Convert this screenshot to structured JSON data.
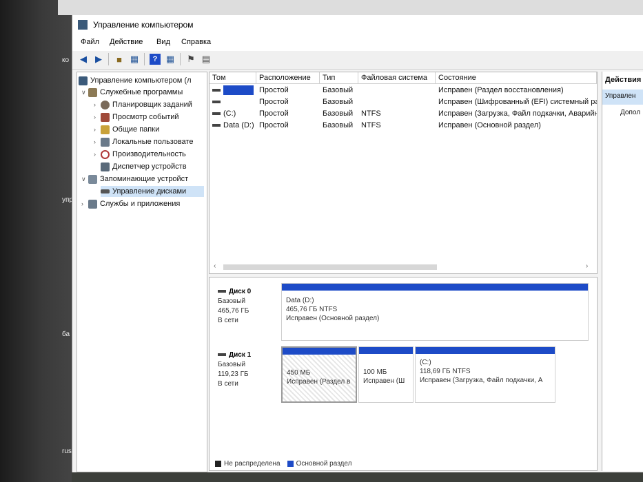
{
  "side": {
    "t1": "ко",
    "t2": "упр",
    "t3": "ба",
    "t4": "rus"
  },
  "window": {
    "title": "Управление компьютером"
  },
  "menu": [
    "Файл",
    "Действие",
    "Вид",
    "Справка"
  ],
  "toolbar": [
    "back-icon",
    "forward-icon",
    "up-icon",
    "view-icon",
    "help-icon",
    "properties-icon",
    "connect-icon",
    "list-icon"
  ],
  "tree": {
    "root": "Управление компьютером (л",
    "items": [
      {
        "label": "Служебные программы",
        "level": 1,
        "expanded": true
      },
      {
        "label": "Планировщик заданий",
        "level": 2
      },
      {
        "label": "Просмотр событий",
        "level": 2
      },
      {
        "label": "Общие папки",
        "level": 2
      },
      {
        "label": "Локальные пользовате",
        "level": 2
      },
      {
        "label": "Производительность",
        "level": 2
      },
      {
        "label": "Диспетчер устройств",
        "level": 2
      },
      {
        "label": "Запоминающие устройст",
        "level": 1,
        "expanded": true
      },
      {
        "label": "Управление дисками",
        "level": 2,
        "selected": true
      },
      {
        "label": "Службы и приложения",
        "level": 1
      }
    ]
  },
  "volumes": {
    "headers": [
      "Том",
      "Расположение",
      "Тип",
      "Файловая система",
      "Состояние"
    ],
    "rows": [
      {
        "tom": "",
        "loc": "Простой",
        "type": "Базовый",
        "fs": "",
        "state": "Исправен (Раздел восстановления)"
      },
      {
        "tom": "",
        "loc": "Простой",
        "type": "Базовый",
        "fs": "",
        "state": "Исправен (Шифрованный (EFI) системный ра"
      },
      {
        "tom": "(C:)",
        "loc": "Простой",
        "type": "Базовый",
        "fs": "NTFS",
        "state": "Исправен (Загрузка, Файл подкачки, Аварийн"
      },
      {
        "tom": "Data (D:)",
        "loc": "Простой",
        "type": "Базовый",
        "fs": "NTFS",
        "state": "Исправен (Основной раздел)"
      }
    ]
  },
  "disks": [
    {
      "name": "Диск 0",
      "kind": "Базовый",
      "size": "465,76 ГБ",
      "status": "В сети",
      "partitions": [
        {
          "title": "Data  (D:)",
          "size": "465,76 ГБ NTFS",
          "state": "Исправен (Основной раздел)"
        }
      ]
    },
    {
      "name": "Диск 1",
      "kind": "Базовый",
      "size": "119,23 ГБ",
      "status": "В сети",
      "partitions": [
        {
          "title": "",
          "size": "450 МБ",
          "state": "Исправен (Раздел в"
        },
        {
          "title": "",
          "size": "100 МБ",
          "state": "Исправен (Ш"
        },
        {
          "title": "(C:)",
          "size": "118,69 ГБ NTFS",
          "state": "Исправен (Загрузка, Файл подкачки, А"
        }
      ]
    }
  ],
  "legend": {
    "unallocated": "Не распределена",
    "primary": "Основной раздел"
  },
  "actions": {
    "header": "Действия",
    "selected": "Управлен",
    "more": "Допол"
  },
  "colors": {
    "partition_bar": "#1d4bc7",
    "unallocated": "#222222",
    "selection": "#cfe3f7"
  }
}
